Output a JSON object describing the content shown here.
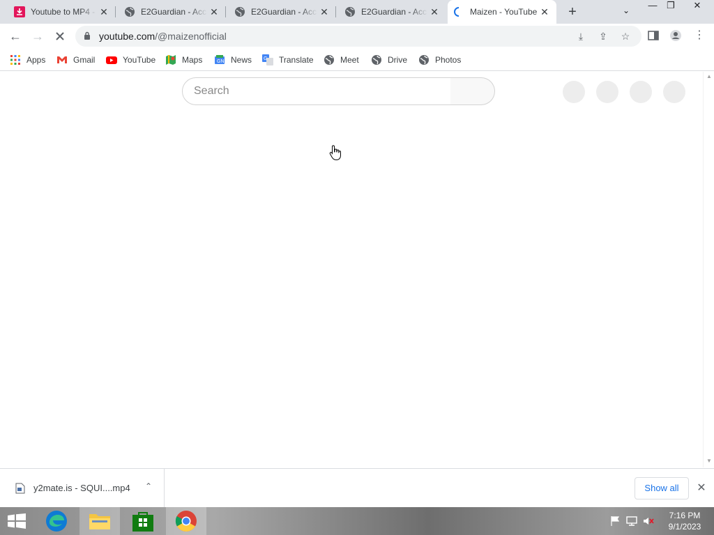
{
  "browser": {
    "tabs": [
      {
        "title": "Youtube to MP4 -",
        "icon": "download-favicon",
        "active": false
      },
      {
        "title": "E2Guardian - Acc",
        "icon": "globe-icon",
        "active": false
      },
      {
        "title": "E2Guardian - Acc",
        "icon": "globe-icon",
        "active": false
      },
      {
        "title": "E2Guardian - Acc",
        "icon": "globe-icon",
        "active": false
      },
      {
        "title": "Maizen - YouTube",
        "icon": "loading-spinner-icon",
        "active": true
      }
    ],
    "address": {
      "host": "youtube.com",
      "path": "/@maizenofficial"
    },
    "bookmarks": [
      {
        "label": "Apps",
        "icon": "apps-grid-icon"
      },
      {
        "label": "Gmail",
        "icon": "gmail-icon"
      },
      {
        "label": "YouTube",
        "icon": "youtube-icon"
      },
      {
        "label": "Maps",
        "icon": "maps-icon"
      },
      {
        "label": "News",
        "icon": "news-icon"
      },
      {
        "label": "Translate",
        "icon": "translate-icon"
      },
      {
        "label": "Meet",
        "icon": "globe-icon"
      },
      {
        "label": "Drive",
        "icon": "globe-icon"
      },
      {
        "label": "Photos",
        "icon": "globe-icon"
      }
    ]
  },
  "page": {
    "search_placeholder": "Search"
  },
  "downloads": {
    "file_name": "y2mate.is - SQUI....mp4",
    "show_all_label": "Show all"
  },
  "taskbar": {
    "time": "7:16 PM",
    "date": "9/1/2023"
  },
  "colors": {
    "accent": "#1a73e8",
    "youtube_red": "#ff0000",
    "tabbar": "#dee1e6"
  }
}
